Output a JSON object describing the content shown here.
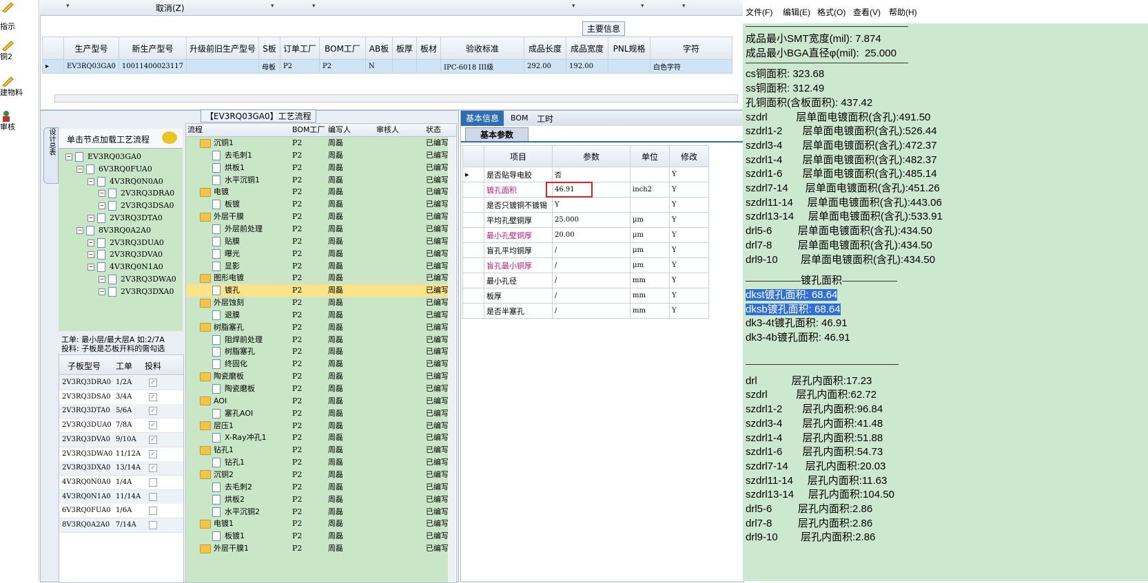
{
  "left_toolbar": {
    "items": [
      "指示",
      "铜2",
      "建物料",
      "审核"
    ]
  },
  "top_bar": {
    "cancel": "取消(Z)"
  },
  "main_info": {
    "title": "主要信息",
    "headers": [
      "生产型号",
      "新生产型号",
      "升级前旧生产型号",
      "S板",
      "订单工厂",
      "BOM工厂",
      "AB板",
      "板厚",
      "板材",
      "验收标准",
      "成品长度",
      "成品宽度",
      "PNL规格",
      "字符"
    ],
    "row": [
      "EV3RQ03GA0",
      "10011400023117",
      "",
      "母板",
      "P2",
      "P2",
      "N",
      "",
      "",
      "IPC-6018 III级",
      "292.00",
      "192.00",
      "",
      "白色字符"
    ]
  },
  "process_panel": {
    "title": "【EV3RQ03GA0】工艺流程",
    "side_tab": "设计总表",
    "hint": "单击节点加载工艺流程",
    "tree": [
      {
        "label": "EV3RQ03GA0",
        "level": 0
      },
      {
        "label": "6V3RQ0FUA0",
        "level": 1
      },
      {
        "label": "4V3RQ0N0A0",
        "level": 2
      },
      {
        "label": "2V3RQ3DRA0",
        "level": 3
      },
      {
        "label": "2V3RQ3DSA0",
        "level": 3
      },
      {
        "label": "2V3RQ3DTA0",
        "level": 2
      },
      {
        "label": "8V3RQ0A2A0",
        "level": 1
      },
      {
        "label": "2V3RQ3DUA0",
        "level": 2
      },
      {
        "label": "2V3RQ3DVA0",
        "level": 2
      },
      {
        "label": "4V3RQ0N1A0",
        "level": 2
      },
      {
        "label": "2V3RQ3DWA0",
        "level": 3
      },
      {
        "label": "2V3RQ3DXA0",
        "level": 3
      }
    ],
    "note1": "工单: 最小层/最大层A 如:2/7A",
    "note2": "投料: 子板是芯板开料的需勾选",
    "sub_headers": [
      "子板型号",
      "工单",
      "投料"
    ],
    "sub_rows": [
      {
        "model": "2V3RQ3DRA0",
        "order": "1/2A",
        "checked": true
      },
      {
        "model": "2V3RQ3DSA0",
        "order": "3/4A",
        "checked": true
      },
      {
        "model": "2V3RQ3DTA0",
        "order": "5/6A",
        "checked": true
      },
      {
        "model": "2V3RQ3DUA0",
        "order": "7/8A",
        "checked": true
      },
      {
        "model": "2V3RQ3DVA0",
        "order": "9/10A",
        "checked": true
      },
      {
        "model": "2V3RQ3DWA0",
        "order": "11/12A",
        "checked": true
      },
      {
        "model": "2V3RQ3DXA0",
        "order": "13/14A",
        "checked": true
      },
      {
        "model": "4V3RQ0N0A0",
        "order": "1/4A",
        "checked": false
      },
      {
        "model": "4V3RQ0N1A0",
        "order": "11/14A",
        "checked": false
      },
      {
        "model": "6V3RQ0FUA0",
        "order": "1/6A",
        "checked": false
      },
      {
        "model": "8V3RQ0A2A0",
        "order": "7/14A",
        "checked": false
      }
    ],
    "flow_headers": [
      "流程",
      "BOM工厂",
      "编写人",
      "审核人",
      "状态"
    ],
    "flow": [
      {
        "name": "沉铜1",
        "folder": true
      },
      {
        "name": "去毛刺1",
        "folder": false
      },
      {
        "name": "烘板1",
        "folder": false
      },
      {
        "name": "水平沉铜1",
        "folder": false
      },
      {
        "name": "电镀",
        "folder": true
      },
      {
        "name": "板镀",
        "folder": false
      },
      {
        "name": "外层干膜",
        "folder": true
      },
      {
        "name": "外层前处理",
        "folder": false
      },
      {
        "name": "贴膜",
        "folder": false
      },
      {
        "name": "曝光",
        "folder": false
      },
      {
        "name": "显影",
        "folder": false
      },
      {
        "name": "图形电镀",
        "folder": true
      },
      {
        "name": "镀孔",
        "folder": false,
        "selected": true
      },
      {
        "name": "外层蚀刻",
        "folder": true
      },
      {
        "name": "退膜",
        "folder": false
      },
      {
        "name": "树脂塞孔",
        "folder": true
      },
      {
        "name": "阻焊前处理",
        "folder": false
      },
      {
        "name": "树脂塞孔",
        "folder": false
      },
      {
        "name": "终固化",
        "folder": false
      },
      {
        "name": "陶瓷磨板",
        "folder": true
      },
      {
        "name": "陶瓷磨板",
        "folder": false
      },
      {
        "name": "AOI",
        "folder": true
      },
      {
        "name": "塞孔AOI",
        "folder": false
      },
      {
        "name": "层压1",
        "folder": true
      },
      {
        "name": "X-Ray冲孔1",
        "folder": false
      },
      {
        "name": "钻孔1",
        "folder": true
      },
      {
        "name": "钻孔1",
        "folder": false
      },
      {
        "name": "沉铜2",
        "folder": true
      },
      {
        "name": "去毛刺2",
        "folder": false
      },
      {
        "name": "烘板2",
        "folder": false
      },
      {
        "name": "水平沉铜2",
        "folder": false
      },
      {
        "name": "电镀1",
        "folder": true
      },
      {
        "name": "板镀1",
        "folder": false
      },
      {
        "name": "外层干膜1",
        "folder": true
      }
    ],
    "flow_bom": "P2",
    "flow_author": "周磊",
    "flow_status": "已编写"
  },
  "basic_panel": {
    "tabs": [
      "基本信息",
      "BOM",
      "工时"
    ],
    "subtab": "基本参数",
    "headers": [
      "项目",
      "参数",
      "单位",
      "修改"
    ],
    "rows": [
      {
        "item": "是否贴导电胶",
        "value": "否",
        "unit": "",
        "mod": "Y",
        "pink": false
      },
      {
        "item": "镀孔面积",
        "value": "46.91",
        "unit": "inch2",
        "mod": "Y",
        "pink": true
      },
      {
        "item": "是否只镀铜不镀锡",
        "value": "Y",
        "unit": "",
        "mod": "Y",
        "pink": false
      },
      {
        "item": "平均孔壁铜厚",
        "value": "25.000",
        "unit": "μm",
        "mod": "Y",
        "pink": false
      },
      {
        "item": "最小孔壁铜厚",
        "value": "20.00",
        "unit": "μm",
        "mod": "Y",
        "pink": true
      },
      {
        "item": "盲孔平均铜厚",
        "value": "/",
        "unit": "μm",
        "mod": "Y",
        "pink": false
      },
      {
        "item": "盲孔最小铜厚",
        "value": "/",
        "unit": "μm",
        "mod": "Y",
        "pink": true
      },
      {
        "item": "最小孔径",
        "value": "/",
        "unit": "mm",
        "mod": "Y",
        "pink": false
      },
      {
        "item": "板厚",
        "value": "/",
        "unit": "mm",
        "mod": "Y",
        "pink": false
      },
      {
        "item": "是否半塞孔",
        "value": "/",
        "unit": "mm",
        "mod": "Y",
        "pink": false
      }
    ]
  },
  "notepad": {
    "menu": [
      "文件(F)",
      "编辑(E)",
      "格式(O)",
      "查看(V)",
      "帮助(H)"
    ],
    "lines": [
      "成品最小SMT宽度(mil): 7.874",
      "成品最小BGA直径φ(mil):  25.000",
      "cs铜面积: 323.68",
      "ss铜面积: 312.49",
      "孔铜面积(含板面积): 437.42",
      "szdrl          层单面电镀面积(含孔):491.50",
      "szdrl1-2       层单面电镀面积(含孔):526.44",
      "szdrl3-4       层单面电镀面积(含孔):472.37",
      "szdrl1-4       层单面电镀面积(含孔):482.37",
      "szdrl1-6       层单面电镀面积(含孔):485.14",
      "szdrl7-14      层单面电镀面积(含孔):451.26",
      "szdrl11-14     层单面电镀面积(含孔):443.06",
      "szdrl13-14     层单面电镀面积(含孔):533.91",
      "drl5-6         层单面电镀面积(含孔):434.50",
      "drl7-8         层单面电镀面积(含孔):434.50",
      "drl9-10        层单面电镀面积(含孔):434.50"
    ],
    "section_title": "镀孔面积",
    "hole_lines": [
      "dkst镀孔面积: 68.64",
      "dksb镀孔面积: 68.64",
      "dk3-4t镀孔面积: 46.91",
      "dk3-4b镀孔面积: 46.91"
    ],
    "inner_lines": [
      "drl            层孔内面积:17.23",
      "szdrl          层孔内面积:62.72",
      "szdrl1-2       层孔内面积:96.84",
      "szdrl3-4       层孔内面积:41.48",
      "szdrl1-4       层孔内面积:51.88",
      "szdrl1-6       层孔内面积:54.73",
      "szdrl7-14      层孔内面积:20.03",
      "szdrl11-14     层孔内面积:11.63",
      "szdrl13-14     层孔内面积:104.50",
      "drl5-6         层孔内面积:2.86",
      "drl7-8         层孔内面积:2.86",
      "drl9-10        层孔内面积:2.86"
    ]
  }
}
